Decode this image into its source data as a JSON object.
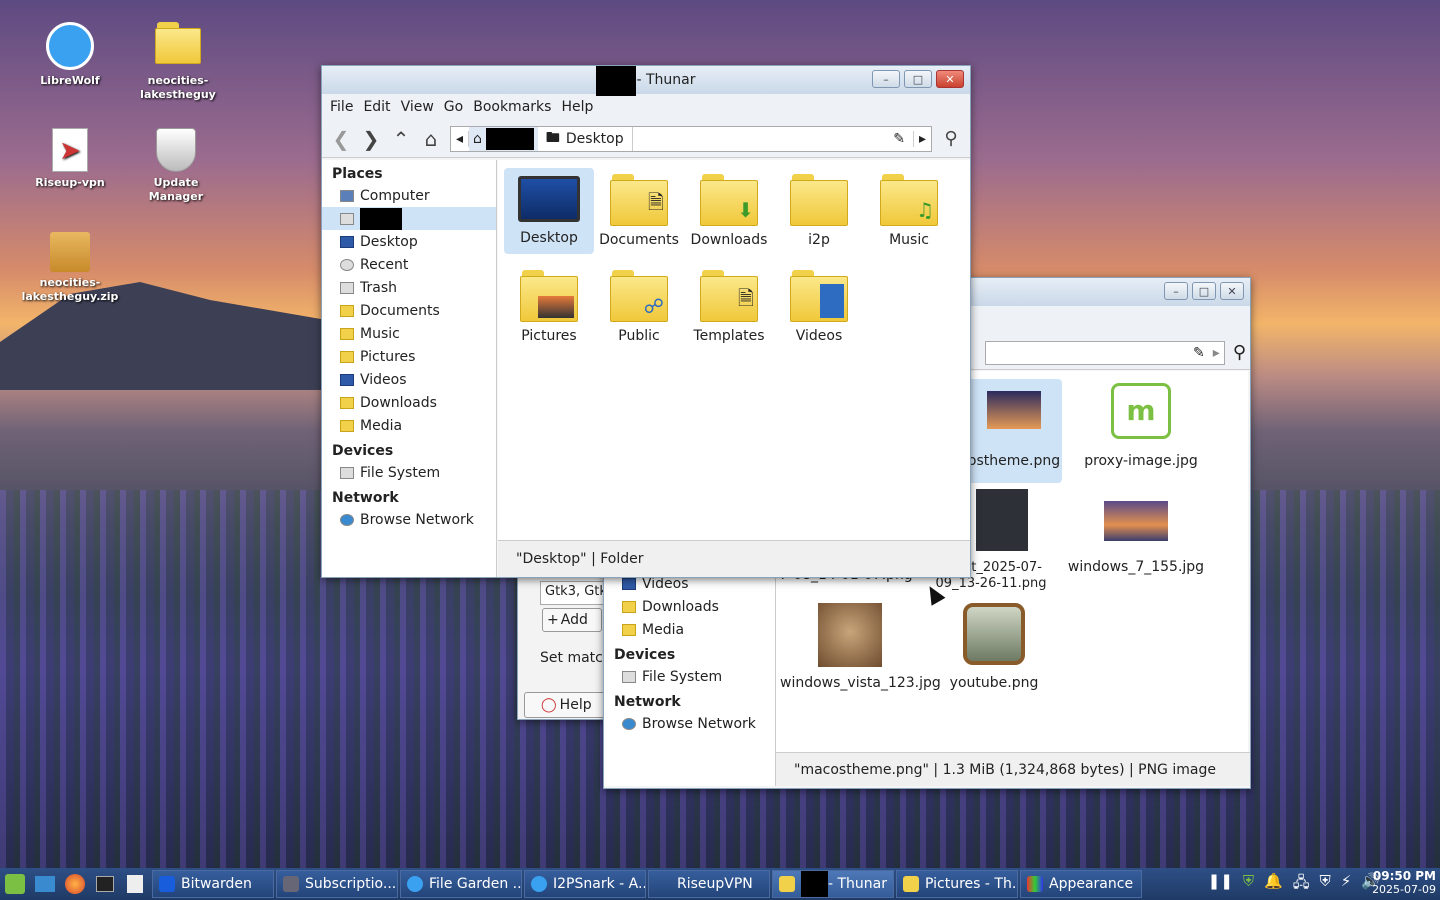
{
  "desktop": {
    "icons": [
      {
        "label": "LibreWolf",
        "icon": "librewolf-icon"
      },
      {
        "label": "neocities-lakestheguy",
        "icon": "folder-icon"
      },
      {
        "label": "Riseup-vpn",
        "icon": "riseup-vpn-icon"
      },
      {
        "label": "Update Manager",
        "icon": "shield-icon"
      },
      {
        "label": "neocities-lakestheguy.zip",
        "icon": "archive-icon"
      }
    ]
  },
  "front_window": {
    "title": "- Thunar",
    "menu": [
      "File",
      "Edit",
      "View",
      "Go",
      "Bookmarks",
      "Help"
    ],
    "path": {
      "current": "Desktop"
    },
    "sidebar": {
      "places_header": "Places",
      "places": [
        "Computer",
        "",
        "Desktop",
        "Recent",
        "Trash",
        "Documents",
        "Music",
        "Pictures",
        "Videos",
        "Downloads",
        "Media"
      ],
      "devices_header": "Devices",
      "devices": [
        "File System"
      ],
      "network_header": "Network",
      "network": [
        "Browse Network"
      ]
    },
    "files": [
      "Desktop",
      "Documents",
      "Downloads",
      "i2p",
      "Music",
      "Pictures",
      "Public",
      "Templates",
      "Videos"
    ],
    "status": "\"Desktop\" | Folder"
  },
  "back_window": {
    "sidebar": {
      "places": [
        "Videos",
        "Downloads",
        "Media"
      ],
      "devices_header": "Devices",
      "devices": [
        "File System"
      ],
      "network_header": "Network",
      "network": [
        "Browse Network"
      ]
    },
    "files": [
      {
        "name": "ostheme.png"
      },
      {
        "name": "proxy-image.jpg"
      },
      {
        "name": "7-08_14-01-07.png"
      },
      {
        "name": "nshot_2025-07-09_13-26-11.png"
      },
      {
        "name": "windows_7_155.jpg"
      },
      {
        "name": "windows_vista_123.jpg"
      },
      {
        "name": "youtube.png"
      }
    ],
    "status": "\"macostheme.png\" | 1.3 MiB (1,324,868 bytes) | PNG image"
  },
  "appearance_window": {
    "field_text": "Gtk3, Gtk",
    "add_label": "Add",
    "set_match_label": "Set matc",
    "help_label": "Help"
  },
  "taskbar": {
    "apps": [
      "Bitwarden",
      "Subscriptio...",
      "File Garden ...",
      "I2PSnark - A...",
      "RiseupVPN",
      "- Thunar",
      "Pictures - Th...",
      "Appearance"
    ],
    "time": "09:50 PM",
    "date": "2025-07-09"
  }
}
